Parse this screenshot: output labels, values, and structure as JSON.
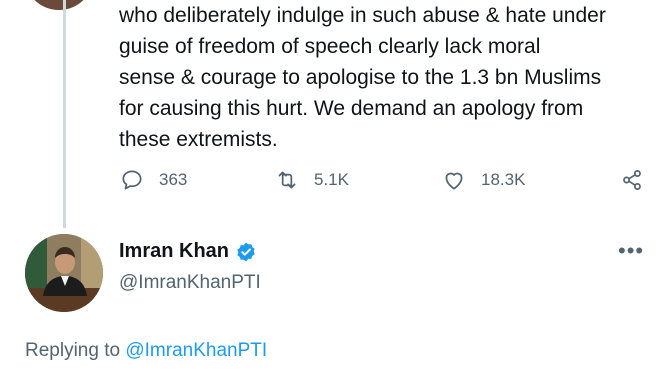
{
  "tweet": {
    "text": "who deliberately indulge in such abuse & hate under\nguise of freedom of speech clearly lack moral\nsense & courage to apologise to the 1.3 bn Muslims\nfor causing this hurt. We demand an apology from\nthese extremists.",
    "replies": "363",
    "retweets": "5.1K",
    "likes": "18.3K"
  },
  "author": {
    "name": "Imran Khan",
    "handle": "@ImranKhanPTI"
  },
  "reply_context": {
    "prefix": "Replying to ",
    "mention": "@ImranKhanPTI"
  },
  "colors": {
    "text": "#0f1419",
    "muted": "#536471",
    "accent": "#1d9bf0",
    "thread_line": "#cfd9de"
  },
  "icons": [
    "reply-icon",
    "retweet-icon",
    "like-icon",
    "share-icon",
    "verified-badge-icon",
    "more-options-icon"
  ]
}
